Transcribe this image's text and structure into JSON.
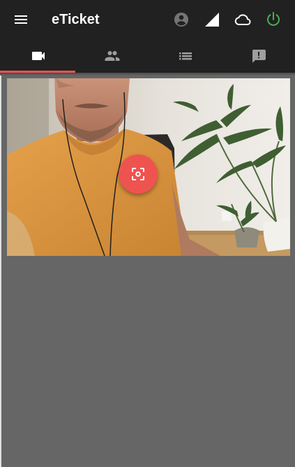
{
  "app": {
    "title": "eTicket"
  },
  "appbar": {
    "menu_icon": "menu-icon",
    "status_icons": [
      "account-circle-icon",
      "signal-icon",
      "cloud-icon",
      "power-icon"
    ],
    "power_color": "#4caf50"
  },
  "tabs": [
    {
      "icon": "videocam-icon",
      "selected": true
    },
    {
      "icon": "people-icon",
      "selected": false
    },
    {
      "icon": "list-icon",
      "selected": false
    },
    {
      "icon": "feedback-icon",
      "selected": false
    }
  ],
  "colors": {
    "appbar": "#212121",
    "accent": "#ef5350",
    "background": "#666666"
  },
  "scanner": {
    "action_icon": "center-focus-icon"
  }
}
